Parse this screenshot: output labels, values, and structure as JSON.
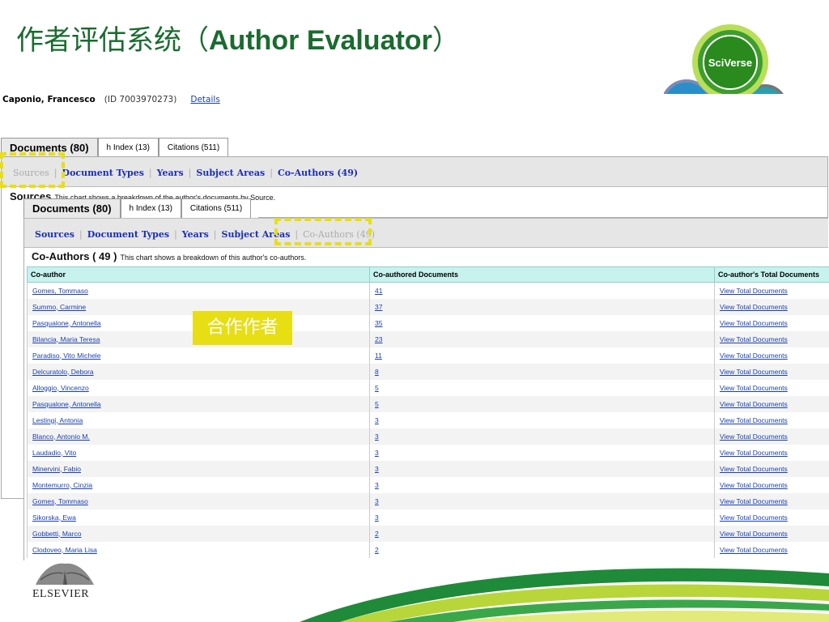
{
  "slide": {
    "title_cn": "作者评估系统（",
    "title_en": "Author Evaluator",
    "title_close": "）"
  },
  "logo": {
    "text": "SciVerse"
  },
  "author": {
    "name": "Caponio, Francesco",
    "id": "(ID 7003970273)",
    "details_label": "Details"
  },
  "back_panel": {
    "tabs": [
      "Documents (80)",
      "h Index (13)",
      "Citations (511)"
    ],
    "subnav": [
      "Sources",
      "Document Types",
      "Years",
      "Subject Areas",
      "Co-Authors (49)"
    ],
    "section_title": "Sources",
    "section_desc": "This chart shows a breakdown of the author's documents by Source."
  },
  "front_panel": {
    "tabs": [
      "Documents (80)",
      "h Index (13)",
      "Citations (511)"
    ],
    "subnav": [
      "Sources",
      "Document Types",
      "Years",
      "Subject Areas",
      "Co-Authors (49)"
    ],
    "section_title": "Co-Authors ( 49 )",
    "section_desc": "This chart shows a breakdown of this author's co-authors.",
    "columns": [
      "Co-author",
      "Co-authored Documents",
      "Co-author's Total Documents"
    ],
    "rows": [
      {
        "name": "Gomes, Tommaso",
        "count": "41",
        "link": "View Total Documents"
      },
      {
        "name": "Summo, Carmine",
        "count": "37",
        "link": "View Total Documents"
      },
      {
        "name": "Pasqualone, Antonella",
        "count": "35",
        "link": "View Total Documents"
      },
      {
        "name": "Bilancia, Maria Teresa",
        "count": "23",
        "link": "View Total Documents"
      },
      {
        "name": "Paradiso, Vito Michele",
        "count": "11",
        "link": "View Total Documents"
      },
      {
        "name": "Delcuratolo, Debora",
        "count": "8",
        "link": "View Total Documents"
      },
      {
        "name": "Alloggio, Vincenzo",
        "count": "5",
        "link": "View Total Documents"
      },
      {
        "name": "Pasqualone, Antonella",
        "count": "5",
        "link": "View Total Documents"
      },
      {
        "name": "Lestingi, Antonia",
        "count": "3",
        "link": "View Total Documents"
      },
      {
        "name": "Blanco, Antonio M.",
        "count": "3",
        "link": "View Total Documents"
      },
      {
        "name": "Laudadio, Vito",
        "count": "3",
        "link": "View Total Documents"
      },
      {
        "name": "Minervini, Fabio",
        "count": "3",
        "link": "View Total Documents"
      },
      {
        "name": "Montemurro, Cinzia",
        "count": "3",
        "link": "View Total Documents"
      },
      {
        "name": "Gomes, Tommaso",
        "count": "3",
        "link": "View Total Documents"
      },
      {
        "name": "Sikorska, Ewa",
        "count": "3",
        "link": "View Total Documents"
      },
      {
        "name": "Gobbetti, Marco",
        "count": "2",
        "link": "View Total Documents"
      },
      {
        "name": "Clodoveo, Maria Lisa",
        "count": "2",
        "link": "View Total Documents"
      }
    ]
  },
  "callout": {
    "text": "合作作者"
  },
  "footer": {
    "publisher": "ELSEVIER"
  },
  "colors": {
    "title": "#1a6b2f",
    "highlight": "#e8de14",
    "link": "#1a3fb0",
    "table_header": "#c8f2ee"
  }
}
